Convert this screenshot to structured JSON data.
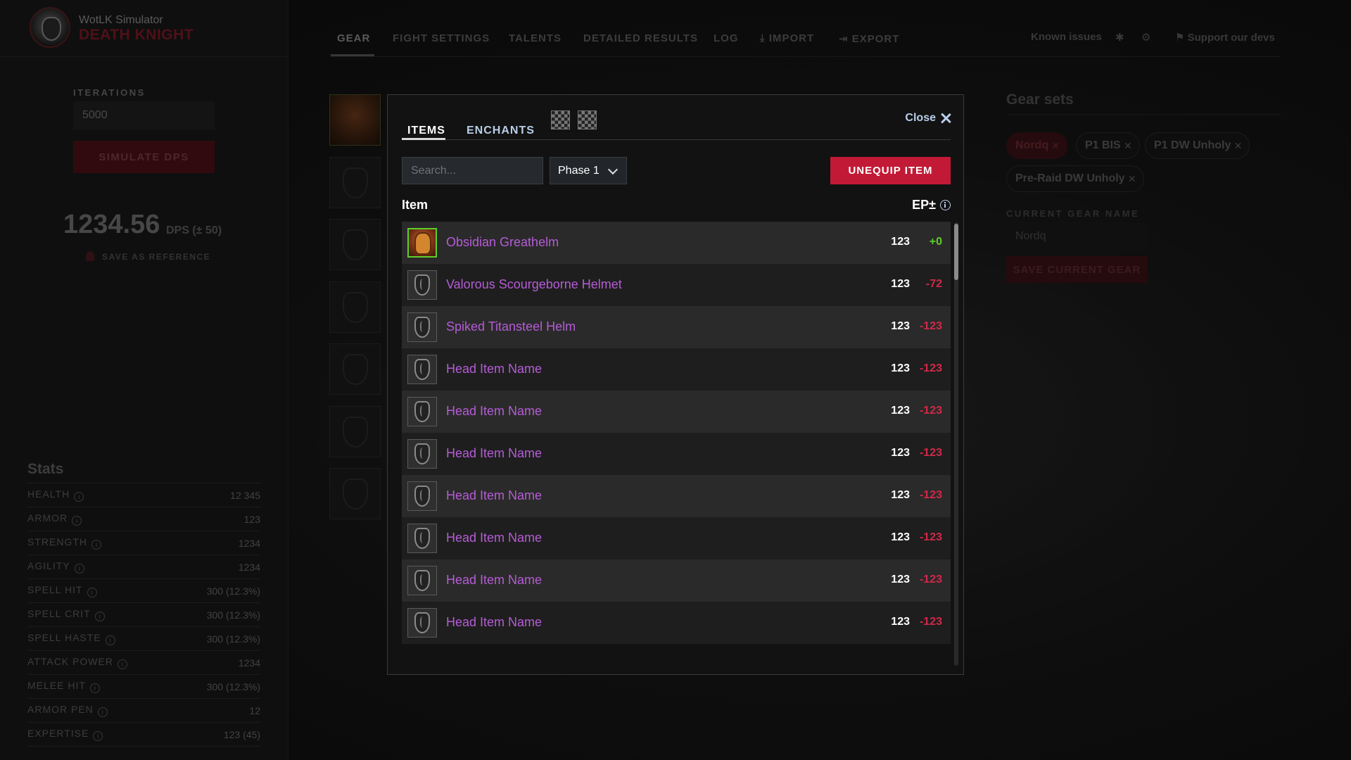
{
  "app": {
    "subtitle": "WotLK Simulator",
    "title": "DEATH KNIGHT"
  },
  "nav": {
    "tabs": [
      "GEAR",
      "FIGHT SETTINGS",
      "TALENTS",
      "DETAILED RESULTS",
      "LOG",
      "IMPORT",
      "EXPORT"
    ],
    "known_issues": "Known issues",
    "support": "Support our devs"
  },
  "sim": {
    "iterations_label": "ITERATIONS",
    "iterations_value": "5000",
    "simulate_label": "SIMULATE DPS",
    "dps_value": "1234.56",
    "dps_unit": "DPS (± 50)",
    "save_reference": "SAVE AS REFERENCE"
  },
  "stats": {
    "title": "Stats",
    "rows": [
      {
        "name": "HEALTH",
        "value": "12 345"
      },
      {
        "name": "ARMOR",
        "value": "123"
      },
      {
        "name": "STRENGTH",
        "value": "1234"
      },
      {
        "name": "AGILITY",
        "value": "1234"
      },
      {
        "name": "SPELL HIT",
        "value": "300 (12.3%)"
      },
      {
        "name": "SPELL CRIT",
        "value": "300 (12.3%)"
      },
      {
        "name": "SPELL HASTE",
        "value": "300 (12.3%)"
      },
      {
        "name": "ATTACK POWER",
        "value": "1234"
      },
      {
        "name": "MELEE HIT",
        "value": "300 (12.3%)"
      },
      {
        "name": "ARMOR PEN",
        "value": "12"
      },
      {
        "name": "EXPERTISE",
        "value": "123 (45)"
      }
    ]
  },
  "gear_sets": {
    "title": "Gear sets",
    "sets": [
      "Nordq",
      "P1 BIS",
      "P1 DW Unholy",
      "Pre-Raid DW Unholy"
    ],
    "current_label": "CURRENT GEAR NAME",
    "current_value": "Nordq",
    "save_label": "SAVE CURRENT GEAR"
  },
  "modal": {
    "tab_items": "ITEMS",
    "tab_enchants": "ENCHANTS",
    "close_label": "Close",
    "search_placeholder": "Search...",
    "phase_value": "Phase 1",
    "unequip_label": "UNEQUIP ITEM",
    "col_item": "Item",
    "col_ep": "EP±",
    "items": [
      {
        "name": "Obsidian Greathelm",
        "ilvl": "123",
        "ep": "+0",
        "equipped": true
      },
      {
        "name": "Valorous Scourgeborne Helmet",
        "ilvl": "123",
        "ep": "-72",
        "equipped": false
      },
      {
        "name": "Spiked Titansteel Helm",
        "ilvl": "123",
        "ep": "-123",
        "equipped": false
      },
      {
        "name": "Head Item Name",
        "ilvl": "123",
        "ep": "-123",
        "equipped": false
      },
      {
        "name": "Head Item Name",
        "ilvl": "123",
        "ep": "-123",
        "equipped": false
      },
      {
        "name": "Head Item Name",
        "ilvl": "123",
        "ep": "-123",
        "equipped": false
      },
      {
        "name": "Head Item Name",
        "ilvl": "123",
        "ep": "-123",
        "equipped": false
      },
      {
        "name": "Head Item Name",
        "ilvl": "123",
        "ep": "-123",
        "equipped": false
      },
      {
        "name": "Head Item Name",
        "ilvl": "123",
        "ep": "-123",
        "equipped": false
      },
      {
        "name": "Head Item Name",
        "ilvl": "123",
        "ep": "-123",
        "equipped": false
      }
    ],
    "colors": {
      "item_name": "#b55cd6",
      "ep_positive": "#5fcf2a",
      "ep_negative": "#d0294a",
      "accent": "#c21a36"
    },
    "icons": [
      "gem-socket-icon",
      "gem-socket-icon",
      "close-icon",
      "chevron-down-icon",
      "info-icon",
      "helm-icon"
    ]
  }
}
